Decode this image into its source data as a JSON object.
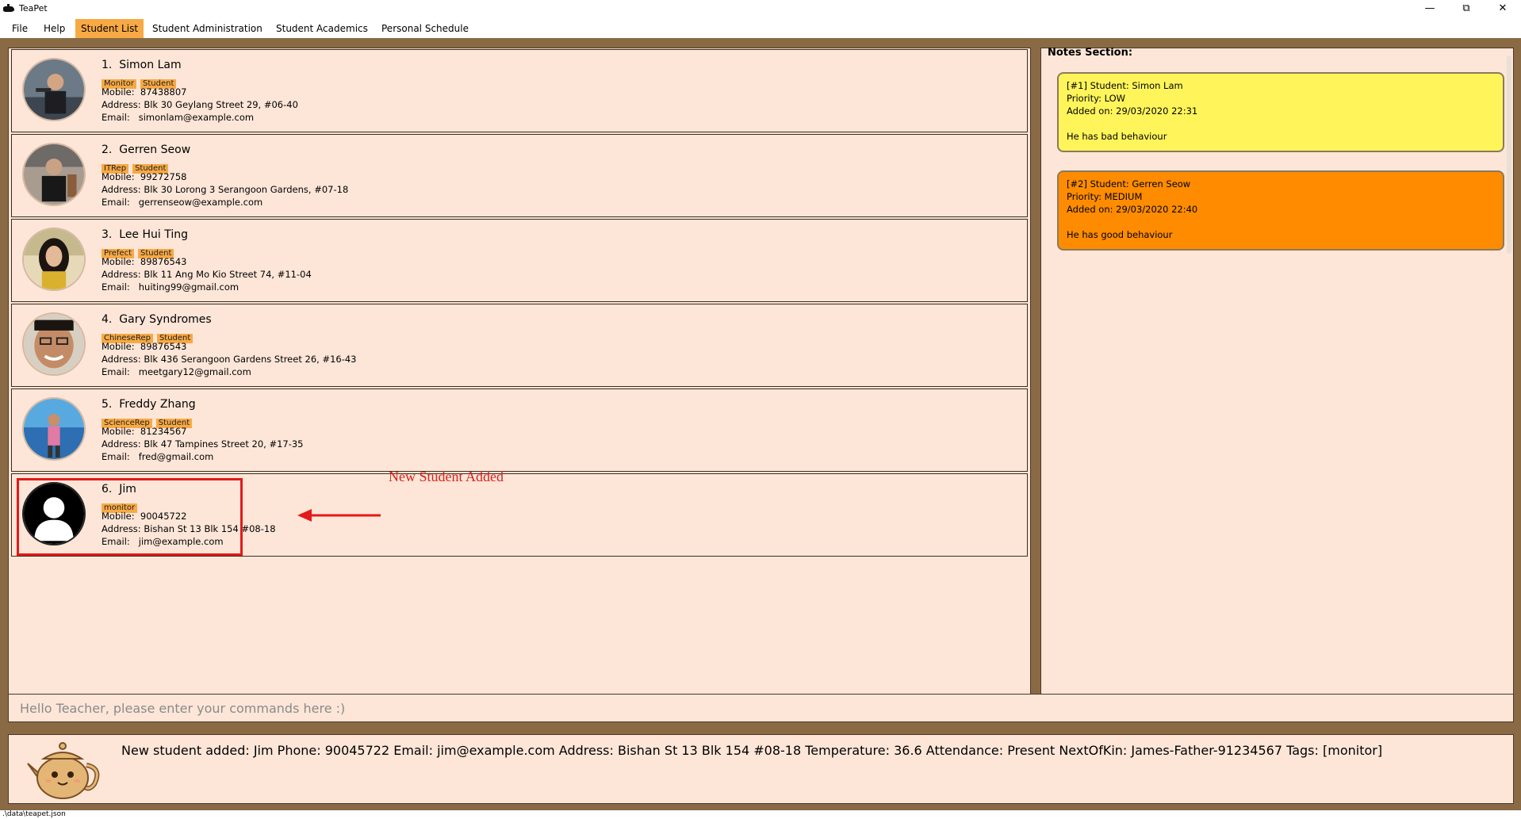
{
  "window": {
    "title": "TeaPet",
    "minimize": "—",
    "restore": "⧉",
    "close": "✕"
  },
  "menu": [
    "File",
    "Help",
    "Student List",
    "Student Administration",
    "Student Academics",
    "Personal Schedule"
  ],
  "menu_active": "Student List",
  "students": [
    {
      "index": "1.",
      "name": "Simon Lam",
      "tags": [
        "Monitor",
        "Student"
      ],
      "mobile_label": "Mobile:",
      "mobile": "87438807",
      "address_label": "Address:",
      "address": "Blk 30 Geylang Street 29, #06-40",
      "email_label": "Email:",
      "email": "simonlam@example.com",
      "avatar": "photo"
    },
    {
      "index": "2.",
      "name": "Gerren Seow",
      "tags": [
        "ITRep",
        "Student"
      ],
      "mobile_label": "Mobile:",
      "mobile": "99272758",
      "address_label": "Address:",
      "address": "Blk 30 Lorong 3 Serangoon Gardens, #07-18",
      "email_label": "Email:",
      "email": "gerrenseow@example.com",
      "avatar": "photo"
    },
    {
      "index": "3.",
      "name": "Lee Hui Ting",
      "tags": [
        "Prefect",
        "Student"
      ],
      "mobile_label": "Mobile:",
      "mobile": "89876543",
      "address_label": "Address:",
      "address": "Blk 11 Ang Mo Kio Street 74, #11-04",
      "email_label": "Email:",
      "email": "huiting99@gmail.com",
      "avatar": "photo"
    },
    {
      "index": "4.",
      "name": "Gary Syndromes",
      "tags": [
        "ChineseRep",
        "Student"
      ],
      "mobile_label": "Mobile:",
      "mobile": "89876543",
      "address_label": "Address:",
      "address": "Blk 436 Serangoon Gardens Street 26, #16-43",
      "email_label": "Email:",
      "email": "meetgary12@gmail.com",
      "avatar": "photo"
    },
    {
      "index": "5.",
      "name": "Freddy Zhang",
      "tags": [
        "ScienceRep",
        "Student"
      ],
      "mobile_label": "Mobile:",
      "mobile": "81234567",
      "address_label": "Address:",
      "address": "Blk 47 Tampines Street 20, #17-35",
      "email_label": "Email:",
      "email": "fred@gmail.com",
      "avatar": "photo"
    },
    {
      "index": "6.",
      "name": "Jim",
      "tags": [
        "monitor"
      ],
      "mobile_label": "Mobile:",
      "mobile": "90045722",
      "address_label": "Address:",
      "address": "Bishan St 13 Blk 154 #08-18",
      "email_label": "Email:",
      "email": "jim@example.com",
      "avatar": "silhouette"
    }
  ],
  "annotation": {
    "text": "New Student Added",
    "color": "#d7221c"
  },
  "notes": {
    "title": "Notes Section:",
    "items": [
      {
        "student": "[#1] Student: Simon Lam",
        "priority": "Priority: LOW",
        "added": "Added on: 29/03/2020 22:31",
        "content": "He has bad behaviour",
        "color": "#fff55a"
      },
      {
        "student": "[#2] Student: Gerren Seow",
        "priority": "Priority: MEDIUM",
        "added": "Added on: 29/03/2020 22:40",
        "content": "He has good behaviour",
        "color": "#ff8c00"
      }
    ]
  },
  "command": {
    "placeholder": "Hello Teacher, please enter your commands here :)",
    "value": ""
  },
  "result": "New student added: Jim Phone: 90045722 Email: jim@example.com Address: Bishan St 13 Blk 154 #08-18 Temperature: 36.6 Attendance: Present NextOfKin: James-Father-91234567 Tags: [monitor]",
  "status": ".\\data\\teapet.json",
  "colors": {
    "brown": "#8a6a45",
    "panel": "#fde6d8",
    "tag": "#f7a944"
  }
}
